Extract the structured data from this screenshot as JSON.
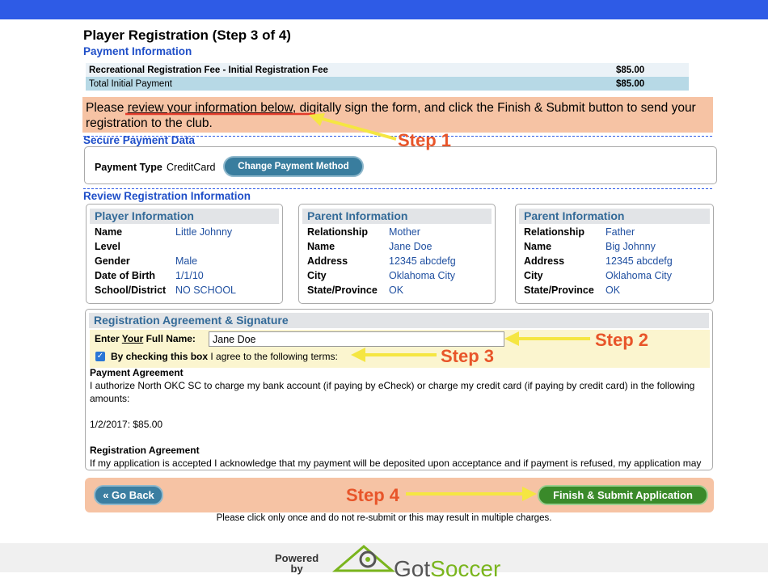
{
  "page": {
    "title": "Player Registration (Step 3 of 4)",
    "payment_info_heading": "Payment Information",
    "fees": [
      {
        "label": "Recreational Registration Fee - Initial Registration Fee",
        "amount": "$85.00"
      },
      {
        "label": "Total Initial Payment",
        "amount": "$85.00"
      }
    ],
    "notice_parts": [
      "Please ",
      "review your information below",
      ", digitally sign the form, and click the Finish & Submit button to send your registration to the club."
    ],
    "secure_heading": "Secure Payment Data",
    "payment_type_label": "Payment Type",
    "payment_type_value": "CreditCard",
    "change_payment_label": "Change Payment Method",
    "review_heading": "Review Registration Information"
  },
  "player": {
    "heading": "Player Information",
    "rows": [
      {
        "k": "Name",
        "v": "Little Johnny"
      },
      {
        "k": "Level",
        "v": ""
      },
      {
        "k": "Gender",
        "v": "Male"
      },
      {
        "k": "Date of Birth",
        "v": "1/1/10"
      },
      {
        "k": "School/District",
        "v": "NO SCHOOL"
      }
    ]
  },
  "parent1": {
    "heading": "Parent Information",
    "rows": [
      {
        "k": "Relationship",
        "v": "Mother"
      },
      {
        "k": "Name",
        "v": "Jane Doe"
      },
      {
        "k": "Address",
        "v": "12345 abcdefg"
      },
      {
        "k": "City",
        "v": "Oklahoma City"
      },
      {
        "k": "State/Province",
        "v": "OK"
      }
    ]
  },
  "parent2": {
    "heading": "Parent Information",
    "rows": [
      {
        "k": "Relationship",
        "v": "Father"
      },
      {
        "k": "Name",
        "v": "Big Johnny"
      },
      {
        "k": "Address",
        "v": "12345 abcdefg"
      },
      {
        "k": "City",
        "v": "Oklahoma City"
      },
      {
        "k": "State/Province",
        "v": "OK"
      }
    ]
  },
  "agreement": {
    "heading": "Registration Agreement & Signature",
    "name_label_pre": "Enter ",
    "name_label_your": "Your",
    "name_label_post": " Full Name:",
    "name_value": "Jane Doe",
    "check_bold": "By checking this box",
    "check_rest": " I agree to the following terms:",
    "payment_agreement_title": "Payment Agreement",
    "payment_agreement_text": "I authorize North OKC SC to charge my bank account (if paying by eCheck) or charge my credit card (if paying by credit card) in the following amounts:",
    "payment_schedule": "1/2/2017: $85.00",
    "registration_agreement_title": "Registration Agreement",
    "registration_agreement_text": "If my application is accepted I acknowledge that my payment will be deposited upon acceptance and if payment is refused, my application may be revoked., and I acknowledge that my application must be reviewed by the club before my application is accepted."
  },
  "footer": {
    "back_label": "« Go Back",
    "finish_label": "Finish & Submit Application",
    "warning": "Please click only once and do not re-submit or this may result in multiple charges.",
    "powered_1": "Powered",
    "powered_2": "by",
    "logo_part1": "Got",
    "logo_part2": "Soccer"
  },
  "annotations": {
    "step1": "Step 1",
    "step2": "Step 2",
    "step3": "Step 3",
    "step4": "Step 4",
    "arrow_color": "#f5e642",
    "text_color": "#e8552a"
  },
  "colors": {
    "topbar": "#2e5be6",
    "heading_blue": "#1e4ec8",
    "notice_bg": "#f6c3a4",
    "button_blue": "#397d9e",
    "button_green": "#3a8a2a"
  }
}
